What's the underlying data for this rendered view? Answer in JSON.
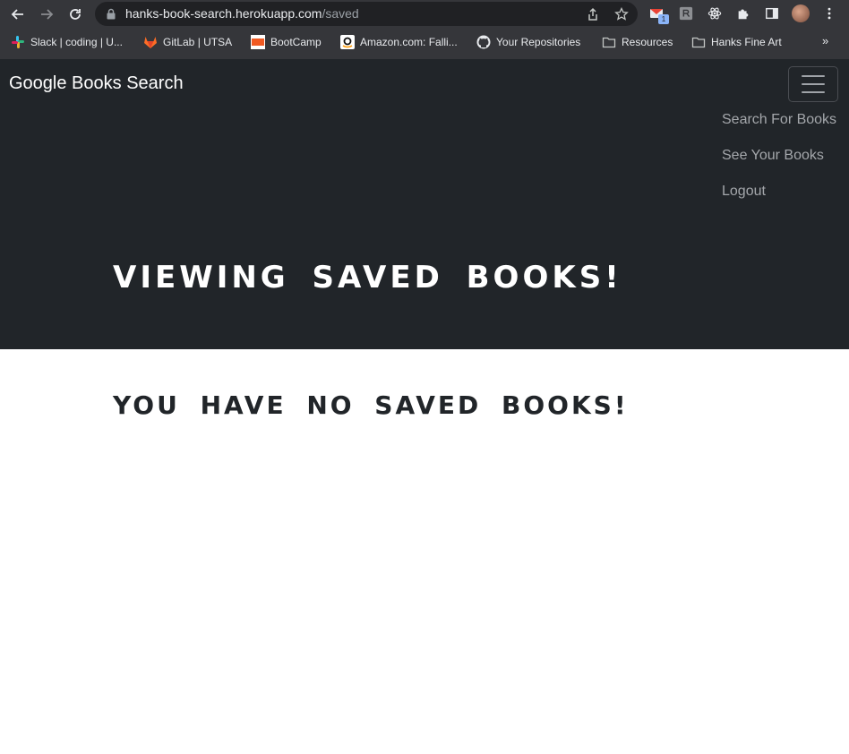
{
  "browser": {
    "url_host": "hanks-book-search.herokuapp.com",
    "url_path": "/saved",
    "extension_badge": "1",
    "bookmarks": [
      {
        "label": "Slack | coding | U...",
        "icon": "slack-icon"
      },
      {
        "label": "GitLab | UTSA",
        "icon": "gitlab-icon"
      },
      {
        "label": "BootCamp",
        "icon": "utsa-icon"
      },
      {
        "label": "Amazon.com: Falli...",
        "icon": "amazon-icon"
      },
      {
        "label": "Your Repositories",
        "icon": "github-icon"
      },
      {
        "label": "Resources",
        "icon": "folder-icon"
      },
      {
        "label": "Hanks Fine Art",
        "icon": "folder-icon"
      }
    ],
    "more_bookmarks": "»"
  },
  "navbar": {
    "brand": "Google Books Search",
    "links": [
      "Search For Books",
      "See Your Books",
      "Logout"
    ]
  },
  "hero": {
    "title": "VIEWING SAVED BOOKS!"
  },
  "content": {
    "empty_message": "YOU HAVE NO SAVED BOOKS!"
  },
  "colors": {
    "navbar_bg": "#212529",
    "chrome_bg": "#35363a",
    "link_muted": "#a4a7ab"
  }
}
